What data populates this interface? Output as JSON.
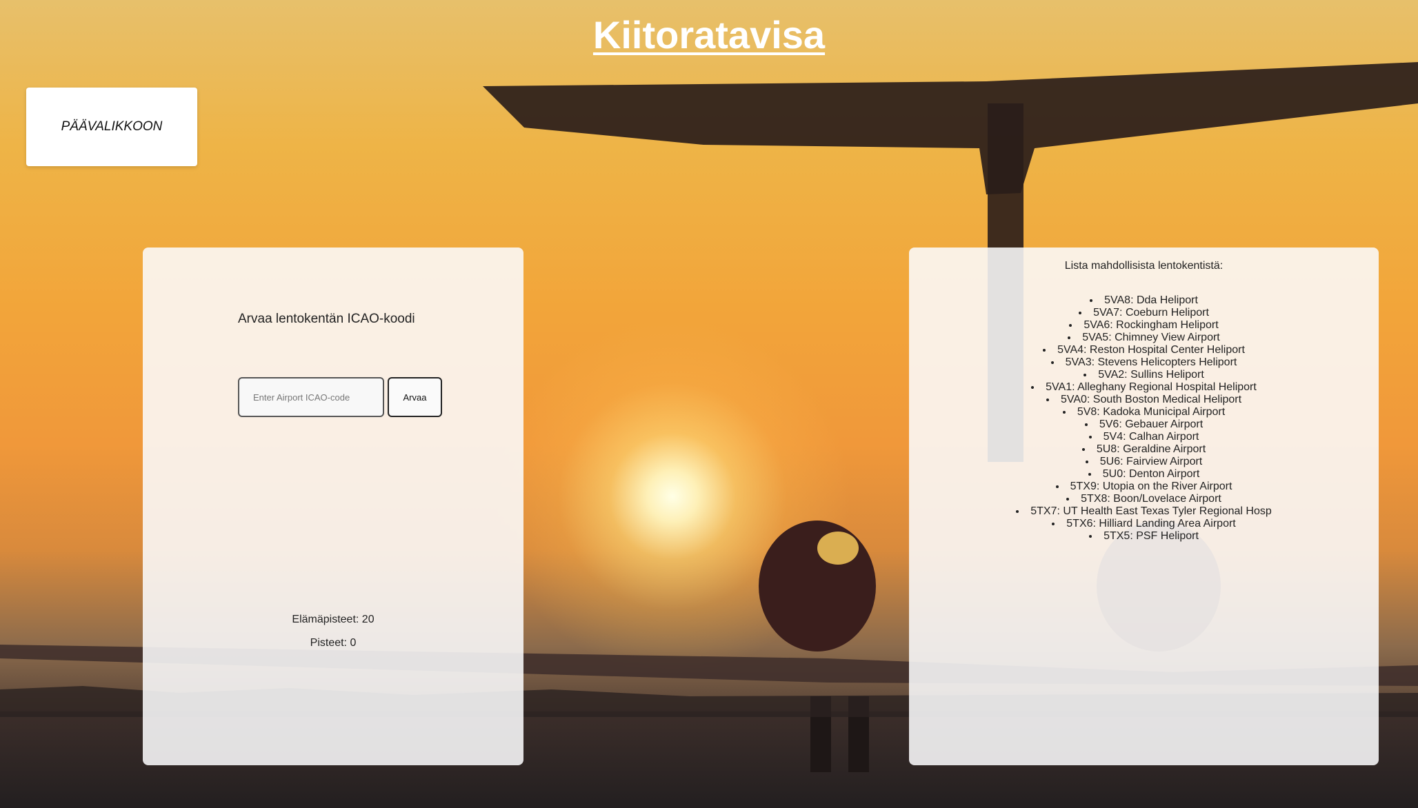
{
  "header": {
    "title": "Kiitoratavisa"
  },
  "nav": {
    "main_menu_label": "PÄÄVALIKKOON"
  },
  "game": {
    "heading": "Arvaa lentokentän ICAO-koodi",
    "input_placeholder": "Enter Airport ICAO-code",
    "input_value": "",
    "guess_label": "Arvaa",
    "lives_text": "Elämäpisteet: 20",
    "score_text": "Pisteet: 0"
  },
  "airports": {
    "title": "Lista mahdollisista lentokentistä:",
    "items": [
      "5VA8: Dda Heliport",
      "5VA7: Coeburn Heliport",
      "5VA6: Rockingham Heliport",
      "5VA5: Chimney View Airport",
      "5VA4: Reston Hospital Center Heliport",
      "5VA3: Stevens Helicopters Heliport",
      "5VA2: Sullins Heliport",
      "5VA1: Alleghany Regional Hospital Heliport",
      "5VA0: South Boston Medical Heliport",
      "5V8: Kadoka Municipal Airport",
      "5V6: Gebauer Airport",
      "5V4: Calhan Airport",
      "5U8: Geraldine Airport",
      "5U6: Fairview Airport",
      "5U0: Denton Airport",
      "5TX9: Utopia on the River Airport",
      "5TX8: Boon/Lovelace Airport",
      "5TX7: UT Health East Texas Tyler Regional Hosp",
      "5TX6: Hilliard Landing Area Airport",
      "5TX5: PSF Heliport"
    ]
  }
}
